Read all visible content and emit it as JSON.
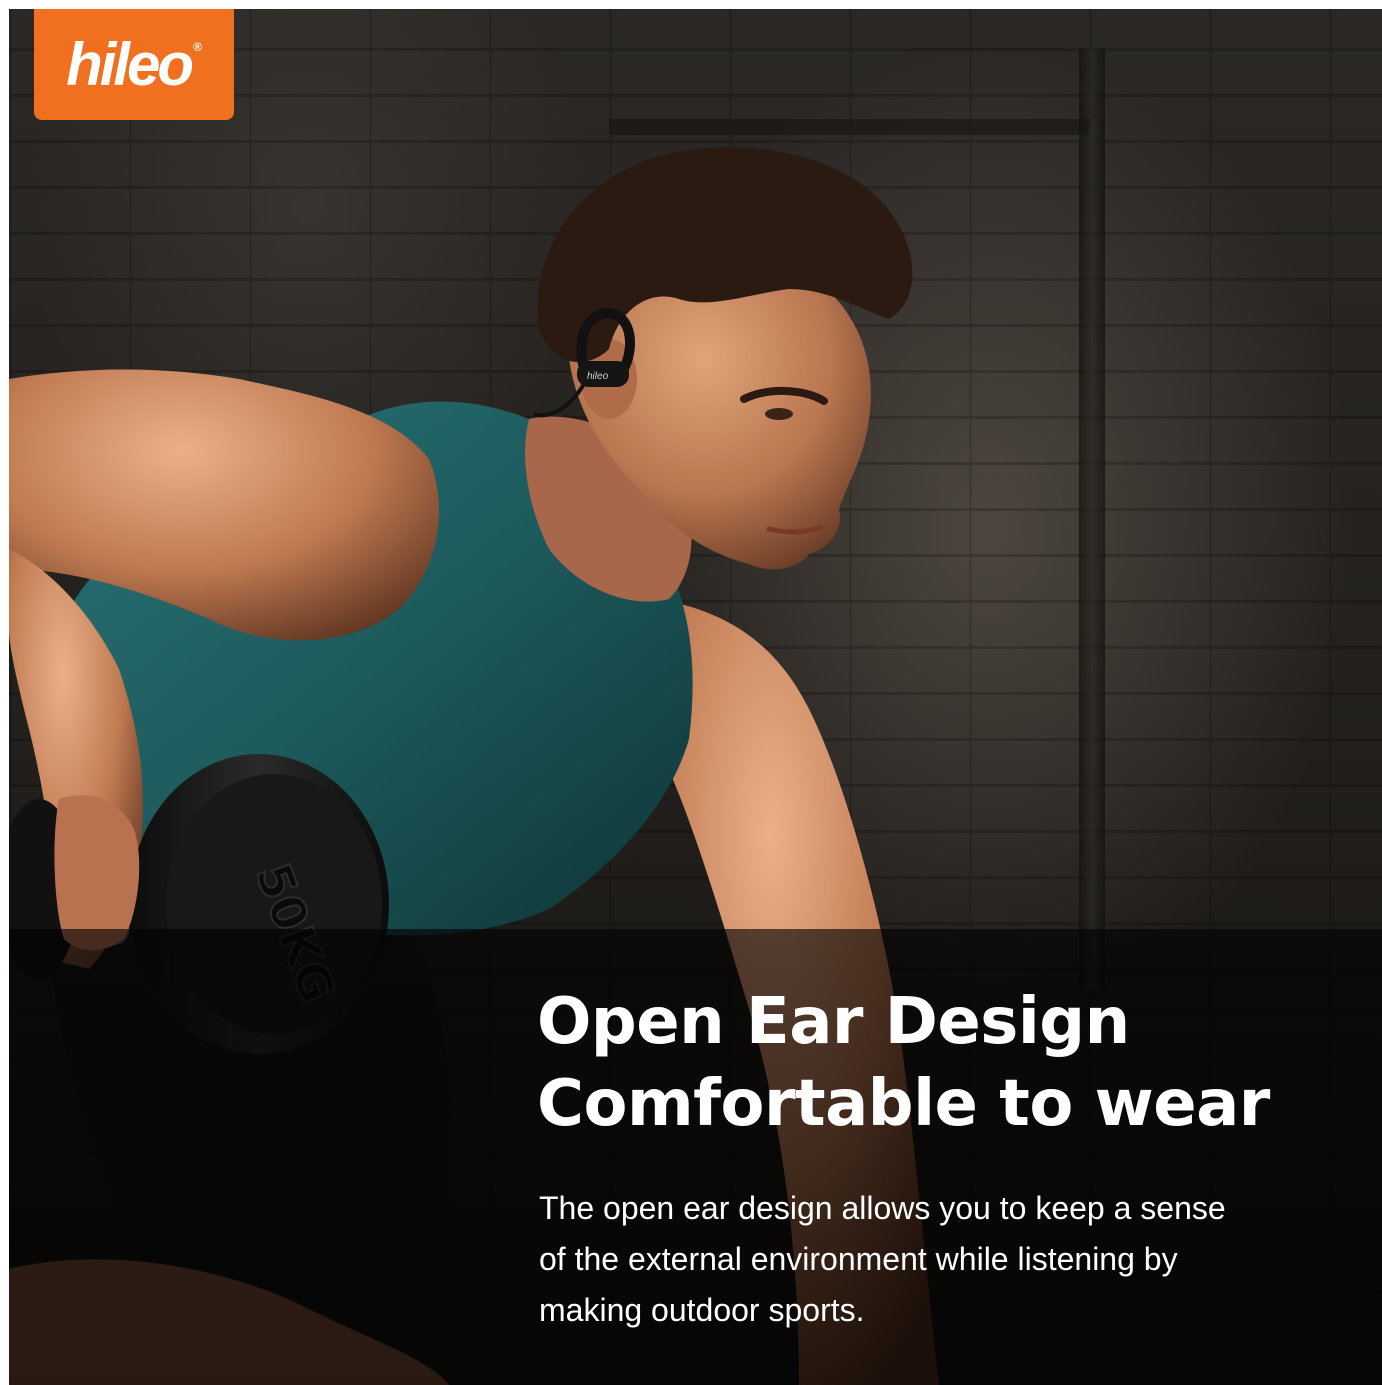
{
  "brand": {
    "logo_text": "hileo",
    "logo_mark": "®",
    "logo_color": "#f07020"
  },
  "feature": {
    "headline_line1": "Open Ear Design",
    "headline_line2": "Comfortable to wear",
    "body_line1": "The open ear design allows you to keep a sense",
    "body_line2": "of the external environment while listening by",
    "body_line3": "making outdoor sports."
  },
  "product": {
    "earbud_label": "hileo",
    "dumbbell_text": "50KG"
  },
  "colors": {
    "tank_top": "#1d5a5c",
    "skin": "#c98a62",
    "hair": "#2a1a12",
    "band": "#000000"
  }
}
